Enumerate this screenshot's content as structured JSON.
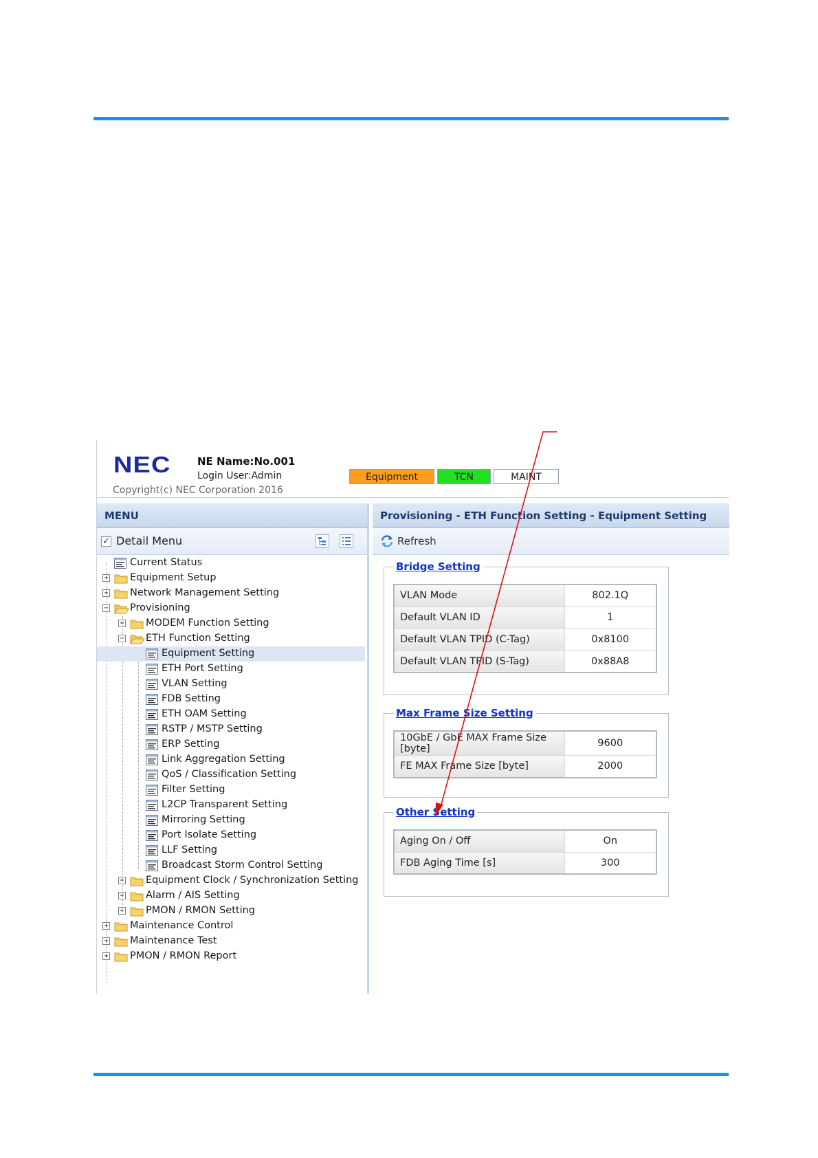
{
  "header": {
    "logo": "NEC",
    "ne_name": "NE Name:No.001",
    "login_user": "Login User:Admin",
    "copyright": "Copyright(c) NEC Corporation 2016",
    "status": {
      "equipment": "Equipment",
      "tcn": "TCN",
      "maint": "MAINT"
    },
    "colors": {
      "equipment": "#ff9d1e",
      "tcn": "#22e022",
      "maint": "#ffffff"
    }
  },
  "menu": {
    "title": "MENU",
    "detail_menu": "Detail Menu",
    "detail_checked": true,
    "items": [
      {
        "label": "Current Status"
      },
      {
        "label": "Equipment Setup"
      },
      {
        "label": "Network Management Setting"
      },
      {
        "label": "Provisioning"
      },
      {
        "label": "MODEM Function Setting"
      },
      {
        "label": "ETH Function Setting"
      },
      {
        "label": "Equipment Setting"
      },
      {
        "label": "ETH Port Setting"
      },
      {
        "label": "VLAN Setting"
      },
      {
        "label": "FDB Setting"
      },
      {
        "label": "ETH OAM Setting"
      },
      {
        "label": "RSTP / MSTP Setting"
      },
      {
        "label": "ERP Setting"
      },
      {
        "label": "Link Aggregation Setting"
      },
      {
        "label": "QoS / Classification Setting"
      },
      {
        "label": "Filter Setting"
      },
      {
        "label": "L2CP Transparent Setting"
      },
      {
        "label": "Mirroring Setting"
      },
      {
        "label": "Port Isolate Setting"
      },
      {
        "label": "LLF Setting"
      },
      {
        "label": "Broadcast Storm Control Setting"
      },
      {
        "label": "Equipment Clock / Synchronization Setting"
      },
      {
        "label": "Alarm / AIS Setting"
      },
      {
        "label": "PMON / RMON Setting"
      },
      {
        "label": "Maintenance Control"
      },
      {
        "label": "Maintenance Test"
      },
      {
        "label": "PMON / RMON Report"
      }
    ]
  },
  "content": {
    "title": "Provisioning - ETH Function Setting - Equipment Setting",
    "refresh": "Refresh",
    "bridge": {
      "title": "Bridge Setting",
      "rows": [
        {
          "label": "VLAN Mode",
          "value": "802.1Q"
        },
        {
          "label": "Default VLAN ID",
          "value": "1"
        },
        {
          "label": "Default VLAN TPID (C-Tag)",
          "value": "0x8100"
        },
        {
          "label": "Default VLAN TPID (S-Tag)",
          "value": "0x88A8"
        }
      ]
    },
    "max_frame": {
      "title": "Max Frame Size Setting",
      "rows": [
        {
          "label": "10GbE / GbE MAX Frame Size [byte]",
          "value": "9600"
        },
        {
          "label": "FE MAX Frame Size [byte]",
          "value": "2000"
        }
      ]
    },
    "other": {
      "title": "Other Setting",
      "rows": [
        {
          "label": "Aging On / Off",
          "value": "On"
        },
        {
          "label": "FDB Aging Time [s]",
          "value": "300"
        }
      ]
    }
  },
  "accent": "#1e90e6"
}
